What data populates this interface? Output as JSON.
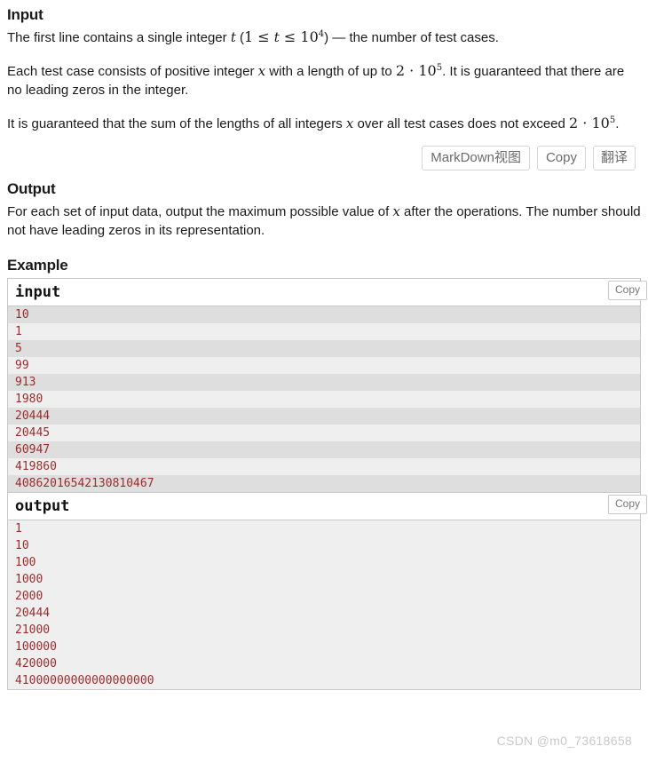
{
  "sections": {
    "input": {
      "heading": "Input",
      "paragraphs": [
        {
          "parts": [
            {
              "t": "text",
              "v": "The first line contains a single integer "
            },
            {
              "t": "var",
              "v": "t"
            },
            {
              "t": "text",
              "v": " ("
            },
            {
              "t": "num",
              "v": "1"
            },
            {
              "t": "op",
              "v": " ≤ "
            },
            {
              "t": "var",
              "v": "t"
            },
            {
              "t": "op",
              "v": " ≤ "
            },
            {
              "t": "num",
              "v": "10"
            },
            {
              "t": "exp",
              "v": "4"
            },
            {
              "t": "text",
              "v": ") — the number of test cases."
            }
          ]
        },
        {
          "parts": [
            {
              "t": "text",
              "v": "Each test case consists of positive integer "
            },
            {
              "t": "var",
              "v": "x"
            },
            {
              "t": "text",
              "v": " with a length of up to "
            },
            {
              "t": "num",
              "v": "2"
            },
            {
              "t": "op",
              "v": " · "
            },
            {
              "t": "num",
              "v": "10"
            },
            {
              "t": "exp",
              "v": "5"
            },
            {
              "t": "text",
              "v": ". It is guaranteed that there are no leading zeros in the integer."
            }
          ]
        },
        {
          "parts": [
            {
              "t": "text",
              "v": "It is guaranteed that the sum of the lengths of all integers "
            },
            {
              "t": "var",
              "v": "x"
            },
            {
              "t": "text",
              "v": " over all test cases does not exceed "
            },
            {
              "t": "num",
              "v": "2"
            },
            {
              "t": "op",
              "v": " · "
            },
            {
              "t": "num",
              "v": "10"
            },
            {
              "t": "exp",
              "v": "5"
            },
            {
              "t": "text",
              "v": "."
            }
          ]
        }
      ]
    },
    "output": {
      "heading": "Output",
      "paragraphs": [
        {
          "parts": [
            {
              "t": "text",
              "v": "For each set of input data, output the maximum possible value of "
            },
            {
              "t": "var",
              "v": "x"
            },
            {
              "t": "text",
              "v": " after the operations. The number should not have leading zeros in its representation."
            }
          ]
        }
      ]
    },
    "example": {
      "heading": "Example"
    }
  },
  "toolbar": {
    "markdown_label": "MarkDown视图",
    "copy_label": "Copy",
    "translate_label": "翻译"
  },
  "example_blocks": [
    {
      "title": "input",
      "copy_label": "Copy",
      "striped": true,
      "lines": [
        "10",
        "1",
        "5",
        "99",
        "913",
        "1980",
        "20444",
        "20445",
        "60947",
        "419860",
        "40862016542130810467"
      ]
    },
    {
      "title": "output",
      "copy_label": "Copy",
      "striped": false,
      "lines": [
        "1",
        "10",
        "100",
        "1000",
        "2000",
        "20444",
        "21000",
        "100000",
        "420000",
        "41000000000000000000"
      ]
    }
  ],
  "watermark": {
    "text": "CSDN @m0_73618658"
  },
  "colors": {
    "code_text": "#9c2c2c",
    "stripe_dark": "#dedede",
    "stripe_light": "#efefef",
    "border": "#c8c8c8",
    "button_text": "#6b6b6b"
  }
}
